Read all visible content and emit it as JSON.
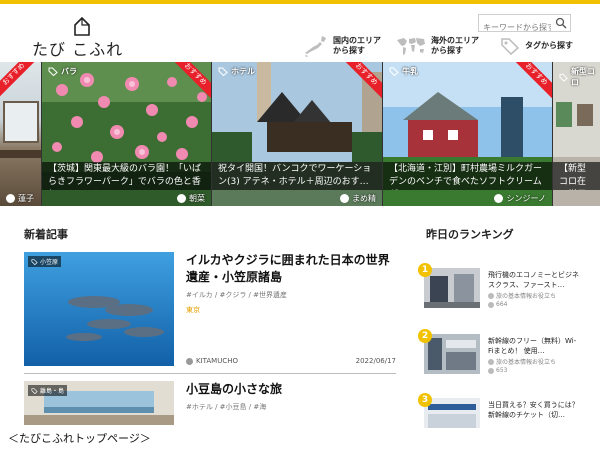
{
  "header": {
    "logo_text": "たび こふれ",
    "search_placeholder": "キーワードから探す",
    "nav": [
      {
        "icon": "japan-map-icon",
        "label1": "国内のエリア",
        "label2": "から探す"
      },
      {
        "icon": "world-map-icon",
        "label1": "海外のエリア",
        "label2": "から探す"
      },
      {
        "icon": "tag-icon",
        "label1": "タグから探す",
        "label2": ""
      }
    ]
  },
  "carousel": [
    {
      "ribbon": "おすすめ",
      "tag": "",
      "caption": "",
      "author": "蓮子"
    },
    {
      "ribbon": "おすすめ",
      "tag": "バラ",
      "caption": "【茨城】関東最大級のバラ園！「いばらきフラワーパーク」でバラの色と香り…",
      "author": "朝菜"
    },
    {
      "ribbon": "おすすめ",
      "tag": "ホテル",
      "caption": "祝タイ開国！バンコクでワーケーション(3) アテネ・ホテル＋周辺のおす…",
      "author": "まめ精"
    },
    {
      "ribbon": "おすすめ",
      "tag": "牛乳",
      "caption": "【北海道・江別】町村農場ミルクガーデンのベンチで食べたソフトクリームが…",
      "author": "シンジーノ"
    },
    {
      "ribbon": "",
      "tag": "新型コロ",
      "caption": "【新型コロ在の様子（",
      "author": ""
    }
  ],
  "new_articles": {
    "title": "新着記事",
    "items": [
      {
        "tag": "小笠原",
        "title": "イルカやクジラに囲まれた日本の世界遺産・小笠原諸島",
        "tags": "#イルカ / #クジラ / #世界遺産",
        "area": "東京",
        "author": "KITAMUCHO",
        "date": "2022/06/17"
      },
      {
        "tag": "離島・島",
        "title": "小豆島の小さな旅",
        "tags": "#ホテル / #小豆島 / #海",
        "area": "",
        "author": "",
        "date": ""
      }
    ]
  },
  "ranking": {
    "title": "昨日のランキング",
    "items": [
      {
        "rank": "1",
        "title": "飛行機のエコノミーとビジネスクラス、ファースト…",
        "source": "旅の基本情報お役立ち",
        "views": "664"
      },
      {
        "rank": "2",
        "title": "新幹線のフリー（無料）Wi-Fiまとめ！ 使用…",
        "source": "旅の基本情報お役立ち",
        "views": "653"
      },
      {
        "rank": "3",
        "title": "当日買える？安く買うには？新幹線のチケット（切…",
        "source": "",
        "views": ""
      }
    ]
  },
  "footer_caption": "＜たびこふれトップページ＞",
  "colors": {
    "accent": "#f2c200",
    "ribbon": "#e8202a",
    "area": "#e8a100"
  }
}
